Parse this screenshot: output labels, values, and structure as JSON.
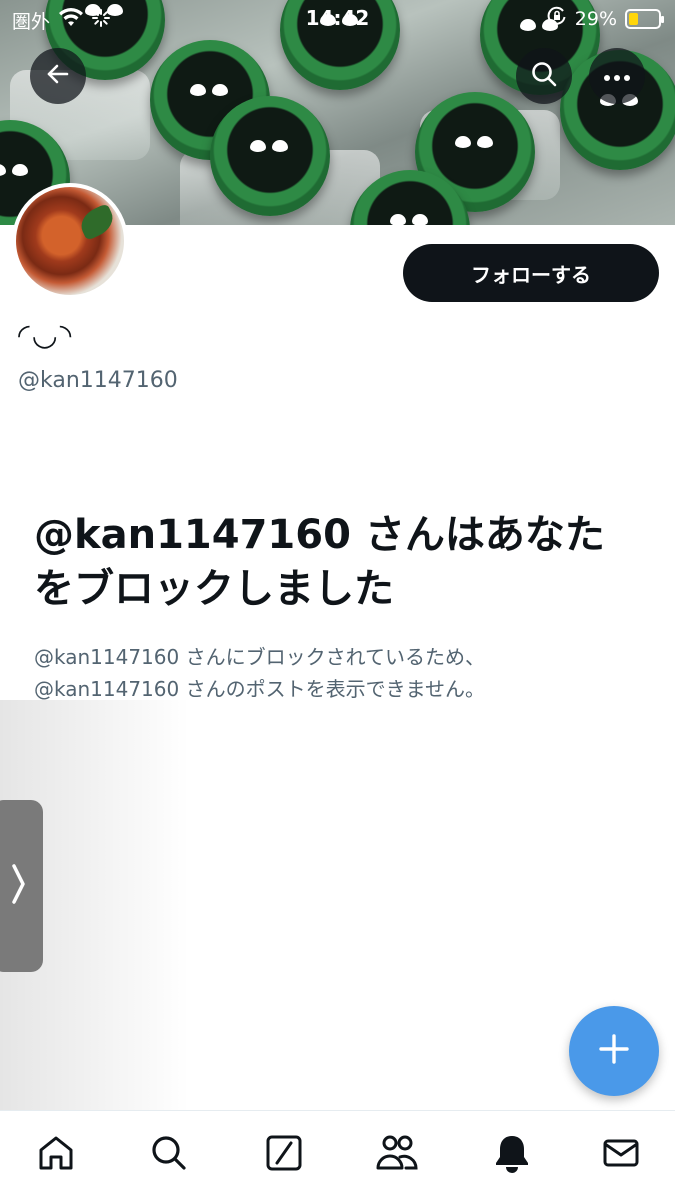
{
  "status_bar": {
    "carrier": "圏外",
    "time": "14:42",
    "battery_percent": "29%",
    "battery_level": 0.29,
    "battery_color": "#ffd60a"
  },
  "header": {
    "back_icon": "arrow-left-icon",
    "search_icon": "search-icon",
    "more_icon": "more-icon"
  },
  "profile": {
    "display_name": "◜◡◝",
    "handle": "@kan1147160",
    "follow_label": "フォローする"
  },
  "blocked": {
    "title": "@kan1147160 さんはあなたをブロックしました",
    "description_line1": "@kan1147160 さんにブロックされているため、",
    "description_line2": "@kan1147160 さんのポストを表示できません。"
  },
  "fab": {
    "icon": "plus-icon",
    "color": "#4a99e9"
  },
  "bottom_nav": {
    "items": [
      "home-icon",
      "search-icon",
      "grok-icon",
      "communities-icon",
      "notifications-icon",
      "messages-icon"
    ]
  },
  "colors": {
    "primary_text": "#0f1419",
    "secondary_text": "#536471",
    "accent": "#4a99e9"
  }
}
